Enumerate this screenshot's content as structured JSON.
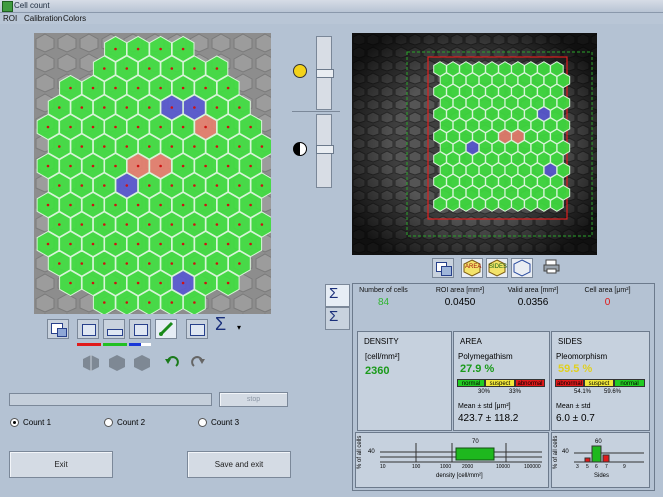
{
  "window": {
    "title": "Cell count"
  },
  "menu": [
    "ROI",
    "Calibration",
    "Colors"
  ],
  "left_toolbar": {
    "sigma": "Σ",
    "dropdown": "▾"
  },
  "progress": {
    "stop_label": "stop"
  },
  "counts": {
    "selected": "Count 1",
    "options": [
      "Count 1",
      "Count 2",
      "Count 3"
    ]
  },
  "buttons": {
    "exit": "Exit",
    "save_exit": "Save and exit"
  },
  "right_toolbar": {
    "area": "AREA",
    "sides": "SIDES"
  },
  "panel_tabs": {
    "sigma1": "Σ",
    "sigma2": "Σ"
  },
  "stats": [
    {
      "label": "Number of cells",
      "value": "84",
      "color": "#2fb62f"
    },
    {
      "label": "ROI area [mm²]",
      "value": "0.0450",
      "color": "#000000"
    },
    {
      "label": "Valid area [mm²]",
      "value": "0.0356",
      "color": "#000000"
    },
    {
      "label": "Cell area [μm²]",
      "value": "0",
      "color": "#e01515"
    }
  ],
  "density": {
    "title": "DENSITY",
    "unit": "[cell/mm²]",
    "value": "2360"
  },
  "area": {
    "title": "AREA",
    "sub": "Polymegathism",
    "percent": "27.9 %",
    "legend": [
      "normal",
      "suspect",
      "abnormal"
    ],
    "pcts": [
      "30%",
      "33%"
    ],
    "mean_label": "Mean ± std [μm²]",
    "mean_value": "423.7 ± 118.2"
  },
  "sides": {
    "title": "SIDES",
    "sub": "Pleomorphism",
    "percent": "59.5 %",
    "legend": [
      "abnormal",
      "suspect",
      "normal"
    ],
    "pcts": [
      "54.1%",
      "59.6%"
    ],
    "mean_label": "Mean ± std",
    "mean_value": "6.0 ± 0.7"
  },
  "hist_density": {
    "ylabel": "% of all cells",
    "y40": "40",
    "peak": "70",
    "ticks": [
      "10",
      "100",
      "1000",
      "2000",
      "10000",
      "100000"
    ],
    "xlabel": "density [cell/mm²]"
  },
  "hist_sides": {
    "ylabel": "% of all cells",
    "y40": "40",
    "peak": "60",
    "ticks": [
      "3",
      "5",
      "6",
      "7",
      "9"
    ],
    "xlabel": "Sides"
  },
  "colors": {
    "cell_normal": "#3fe03f",
    "cell_large": "#e8806e",
    "cell_small": "#5858d2",
    "roi": "#e02020",
    "bg": "#b4c2d3"
  }
}
